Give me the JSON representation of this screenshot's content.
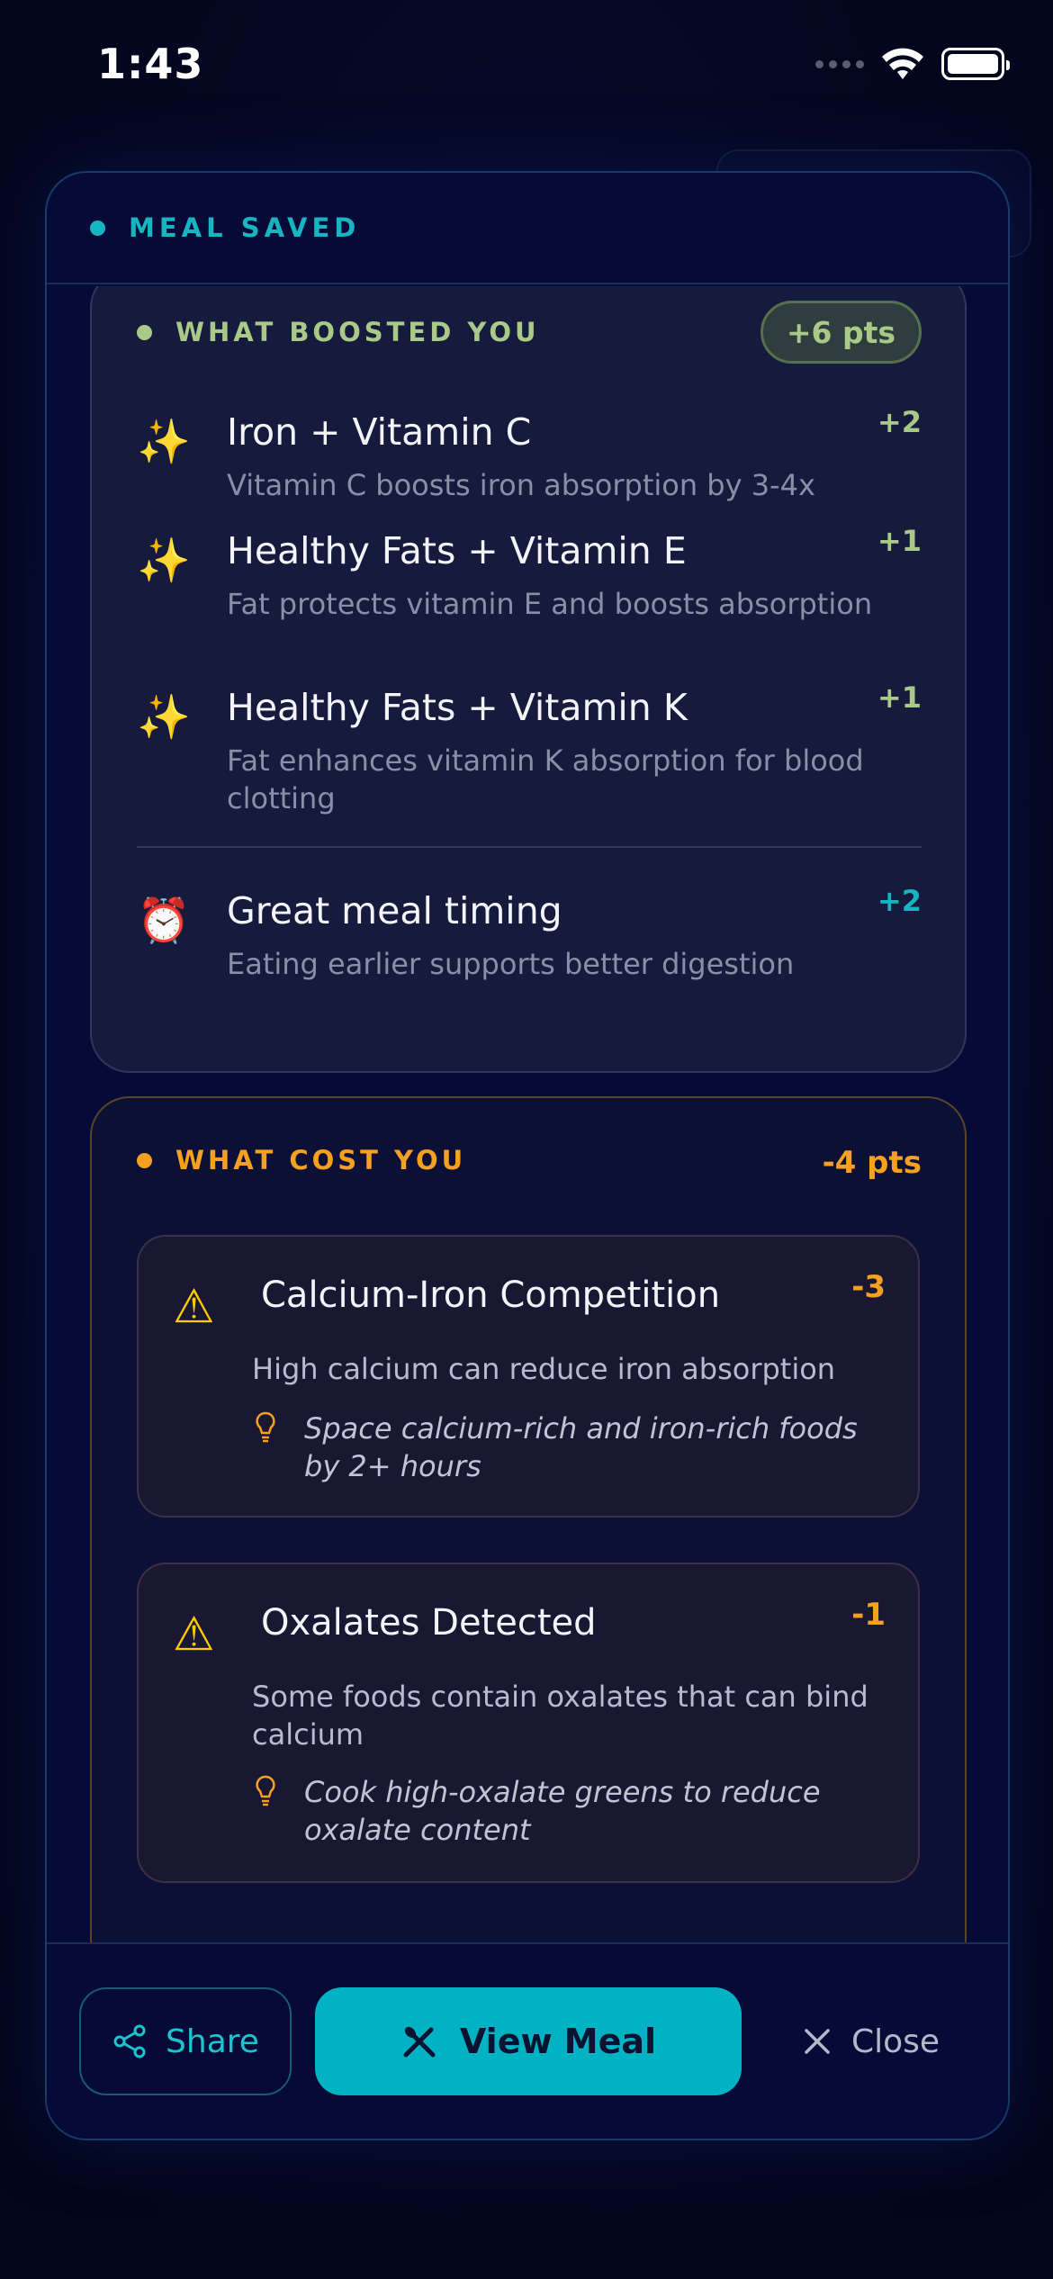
{
  "status_bar": {
    "time": "1:43"
  },
  "header": {
    "label": "MEAL SAVED",
    "dot_color": "#17b5c2"
  },
  "boost": {
    "title": "WHAT BOOSTED YOU",
    "points": "+6 pts",
    "color": "#a8c988",
    "items": [
      {
        "icon": "sparkles-icon",
        "title": "Iron + Vitamin C",
        "desc": "Vitamin C boosts iron absorption by 3-4x",
        "pts": "+2"
      },
      {
        "icon": "sparkles-icon",
        "title": "Healthy Fats + Vitamin E",
        "desc": "Fat protects vitamin E and boosts absorption",
        "pts": "+1"
      },
      {
        "icon": "sparkles-icon",
        "title": "Healthy Fats + Vitamin K",
        "desc": "Fat enhances vitamin K absorption for blood clotting",
        "pts": "+1"
      }
    ],
    "timing": {
      "icon": "alarm-clock-icon",
      "title": "Great meal timing",
      "desc": "Eating earlier supports better digestion",
      "pts": "+2"
    }
  },
  "cost": {
    "title": "WHAT COST YOU",
    "points": "-4 pts",
    "color": "#f5a020",
    "items": [
      {
        "icon": "warning-icon",
        "title": "Calcium-Iron Competition",
        "pts": "-3",
        "desc": "High calcium can reduce iron absorption",
        "tip": "Space calcium-rich and iron-rich foods by 2+ hours"
      },
      {
        "icon": "warning-icon",
        "title": "Oxalates Detected",
        "pts": "-1",
        "desc": "Some foods contain oxalates that can bind calcium",
        "tip": "Cook high-oxalate greens to reduce oxalate content"
      }
    ]
  },
  "footer": {
    "share_label": "Share",
    "view_label": "View Meal",
    "close_label": "Close"
  }
}
